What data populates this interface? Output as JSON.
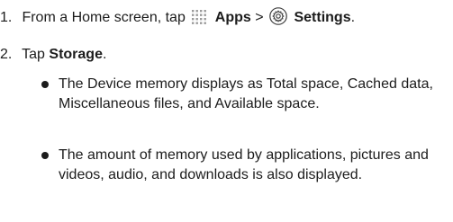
{
  "steps": [
    {
      "number": "1.",
      "text_before": "From a Home screen, tap",
      "apps_icon": "apps-grid-icon",
      "apps_label": "Apps",
      "separator": ">",
      "settings_icon": "settings-gear-icon",
      "settings_label": "Settings",
      "end": "."
    },
    {
      "number": "2.",
      "text_before": "Tap",
      "bold": "Storage",
      "end": "."
    }
  ],
  "bullets": [
    "The Device memory displays as Total space, Cached data, Miscellaneous files, and Available space.",
    "The amount of memory used by applications, pictures and videos, audio, and downloads is also displayed."
  ]
}
